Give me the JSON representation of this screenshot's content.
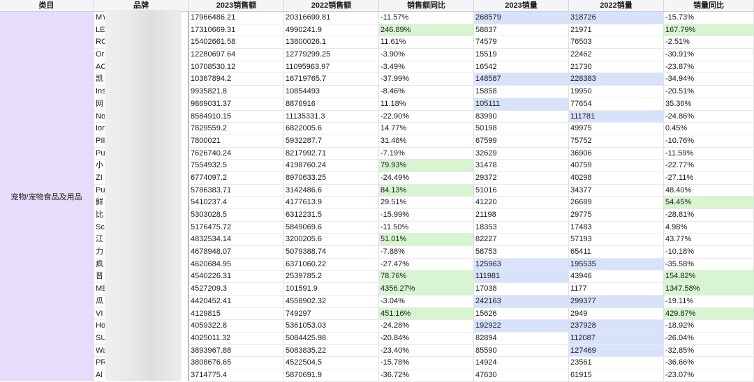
{
  "headers": [
    "类目",
    "品牌",
    "2023销售额",
    "2022销售额",
    "销售额同比",
    "2023销量",
    "2022销量",
    "销量同比"
  ],
  "category": "宠物/宠物食品及用品",
  "rows": [
    {
      "brand": "MY",
      "s2023": "17966486.21",
      "s2022": "20316699.81",
      "syoy": "-11.57%",
      "v2023": "268579",
      "v2022": "318726",
      "vyoy": "-15.73%",
      "hl": {
        "v2023": "b",
        "v2022": "b"
      }
    },
    {
      "brand": "LE",
      "s2023": "17310669.31",
      "s2022": "4990241.9",
      "syoy": "246.89%",
      "v2023": "58837",
      "v2022": "21971",
      "vyoy": "167.79%",
      "hl": {
        "syoy": "g",
        "vyoy": "g"
      }
    },
    {
      "brand": "RC",
      "s2023": "15402661.58",
      "s2022": "13800026.1",
      "syoy": "11.61%",
      "v2023": "74579",
      "v2022": "76503",
      "vyoy": "-2.51%",
      "hl": {}
    },
    {
      "brand": "Or",
      "s2023": "12280697.64",
      "s2022": "12779299.25",
      "syoy": "-3.90%",
      "v2023": "15519",
      "v2022": "22462",
      "vyoy": "-30.91%",
      "hl": {}
    },
    {
      "brand": "AC",
      "s2023": "10708530.12",
      "s2022": "11095963.97",
      "syoy": "-3.49%",
      "v2023": "16542",
      "v2022": "21730",
      "vyoy": "-23.87%",
      "hl": {}
    },
    {
      "brand": "凯",
      "s2023": "10367894.2",
      "s2022": "16719765.7",
      "syoy": "-37.99%",
      "v2023": "148587",
      "v2022": "228383",
      "vyoy": "-34.94%",
      "hl": {
        "v2023": "b",
        "v2022": "b"
      }
    },
    {
      "brand": "Ins",
      "s2023": "9935821.8",
      "s2022": "10854493",
      "syoy": "-8.46%",
      "v2023": "15858",
      "v2022": "19950",
      "vyoy": "-20.51%",
      "hl": {}
    },
    {
      "brand": "网",
      "s2023": "9869031.37",
      "s2022": "8876916",
      "syoy": "11.18%",
      "v2023": "105111",
      "v2022": "77654",
      "vyoy": "35.36%",
      "hl": {
        "v2023": "b"
      }
    },
    {
      "brand": "No",
      "s2023": "8584910.15",
      "s2022": "11135331.3",
      "syoy": "-22.90%",
      "v2023": "83990",
      "v2022": "111781",
      "vyoy": "-24.86%",
      "hl": {
        "v2022": "b"
      }
    },
    {
      "brand": "Ior",
      "s2023": "7829559.2",
      "s2022": "6822005.6",
      "syoy": "14.77%",
      "v2023": "50198",
      "v2022": "49975",
      "vyoy": "0.45%",
      "hl": {}
    },
    {
      "brand": "PII",
      "s2023": "7800021",
      "s2022": "5932287.7",
      "syoy": "31.48%",
      "v2023": "67599",
      "v2022": "75752",
      "vyoy": "-10.76%",
      "hl": {}
    },
    {
      "brand": "Pu",
      "s2023": "7626740.24",
      "s2022": "8217992.71",
      "syoy": "-7.19%",
      "v2023": "32629",
      "v2022": "36906",
      "vyoy": "-11.59%",
      "hl": {}
    },
    {
      "brand": "小",
      "s2023": "7554932.5",
      "s2022": "4198760.24",
      "syoy": "79.93%",
      "v2023": "31478",
      "v2022": "40759",
      "vyoy": "-22.77%",
      "hl": {
        "syoy": "g"
      }
    },
    {
      "brand": "ZI",
      "s2023": "6774097.2",
      "s2022": "8970633.25",
      "syoy": "-24.49%",
      "v2023": "29372",
      "v2022": "40298",
      "vyoy": "-27.11%",
      "hl": {}
    },
    {
      "brand": "Pu",
      "s2023": "5786383.71",
      "s2022": "3142486.6",
      "syoy": "84.13%",
      "v2023": "51016",
      "v2022": "34377",
      "vyoy": "48.40%",
      "hl": {
        "syoy": "g"
      }
    },
    {
      "brand": "鲜",
      "s2023": "5410237.4",
      "s2022": "4177613.9",
      "syoy": "29.51%",
      "v2023": "41220",
      "v2022": "26689",
      "vyoy": "54.45%",
      "hl": {
        "vyoy": "g"
      }
    },
    {
      "brand": "比",
      "s2023": "5303028.5",
      "s2022": "6312231.5",
      "syoy": "-15.99%",
      "v2023": "21198",
      "v2022": "29775",
      "vyoy": "-28.81%",
      "hl": {}
    },
    {
      "brand": "Sc",
      "s2023": "5176475.72",
      "s2022": "5849069.6",
      "syoy": "-11.50%",
      "v2023": "18353",
      "v2022": "17483",
      "vyoy": "4.98%",
      "hl": {}
    },
    {
      "brand": "江",
      "s2023": "4832534.14",
      "s2022": "3200205.6",
      "syoy": "51.01%",
      "v2023": "82227",
      "v2022": "57193",
      "vyoy": "43.77%",
      "hl": {
        "syoy": "g"
      }
    },
    {
      "brand": "力",
      "s2023": "4678948.07",
      "s2022": "5079388.74",
      "syoy": "-7.88%",
      "v2023": "58753",
      "v2022": "65411",
      "vyoy": "-10.18%",
      "hl": {}
    },
    {
      "brand": "疯",
      "s2023": "4620684.95",
      "s2022": "6371060.22",
      "syoy": "-27.47%",
      "v2023": "125963",
      "v2022": "195535",
      "vyoy": "-35.58%",
      "hl": {
        "v2023": "b",
        "v2022": "b"
      }
    },
    {
      "brand": "普",
      "s2023": "4540226.31",
      "s2022": "2539785.2",
      "syoy": "78.76%",
      "v2023": "111981",
      "v2022": "43946",
      "vyoy": "154.82%",
      "hl": {
        "syoy": "g",
        "v2023": "b",
        "vyoy": "g"
      }
    },
    {
      "brand": "ME",
      "s2023": "4527209.3",
      "s2022": "101591.9",
      "syoy": "4356.27%",
      "v2023": "17038",
      "v2022": "1177",
      "vyoy": "1347.58%",
      "hl": {
        "syoy": "g",
        "vyoy": "g"
      }
    },
    {
      "brand": "瓜",
      "s2023": "4420452.41",
      "s2022": "4558902.32",
      "syoy": "-3.04%",
      "v2023": "242163",
      "v2022": "299377",
      "vyoy": "-19.11%",
      "hl": {
        "v2023": "b",
        "v2022": "b"
      }
    },
    {
      "brand": "VI",
      "s2023": "4129815",
      "s2022": "749297",
      "syoy": "451.16%",
      "v2023": "15626",
      "v2022": "2949",
      "vyoy": "429.87%",
      "hl": {
        "syoy": "g",
        "vyoy": "g"
      }
    },
    {
      "brand": "Ho",
      "s2023": "4059322.8",
      "s2022": "5361053.03",
      "syoy": "-24.28%",
      "v2023": "192922",
      "v2022": "237928",
      "vyoy": "-18.92%",
      "hl": {
        "v2023": "b",
        "v2022": "b"
      }
    },
    {
      "brand": "SU",
      "s2023": "4025011.32",
      "s2022": "5084425.98",
      "syoy": "-20.84%",
      "v2023": "82894",
      "v2022": "112087",
      "vyoy": "-26.04%",
      "hl": {
        "v2022": "b"
      }
    },
    {
      "brand": "Wa",
      "s2023": "3893967.88",
      "s2022": "5083835.22",
      "syoy": "-23.40%",
      "v2023": "85590",
      "v2022": "127469",
      "vyoy": "-32.85%",
      "hl": {
        "v2022": "b"
      }
    },
    {
      "brand": "PR",
      "s2023": "3808676.65",
      "s2022": "4522504.5",
      "syoy": "-15.78%",
      "v2023": "14924",
      "v2022": "23561",
      "vyoy": "-36.66%",
      "hl": {}
    },
    {
      "brand": "Al",
      "s2023": "3714775.4",
      "s2022": "5870691.9",
      "syoy": "-36.72%",
      "v2023": "47630",
      "v2022": "61915",
      "vyoy": "-23.07%",
      "hl": {}
    }
  ],
  "colors": {
    "green_highlight": "#d6f5d0",
    "blue_highlight": "#d8e2fb",
    "category_bg": "#e8dcfb"
  }
}
